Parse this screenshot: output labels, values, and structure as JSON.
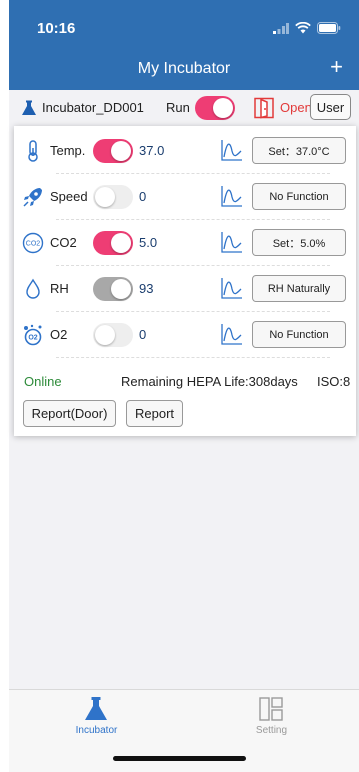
{
  "status_bar": {
    "time": "10:16"
  },
  "nav": {
    "title": "My Incubator",
    "add_label": "+"
  },
  "device": {
    "name": "Incubator_DD001",
    "run_label": "Run",
    "run_on": true,
    "open_label": "Open",
    "user_label": "User"
  },
  "params": [
    {
      "key": "temp",
      "icon": "thermometer-icon",
      "label": "Temp.",
      "toggle": "on",
      "value": "37.0",
      "button": "Set：37.0°C"
    },
    {
      "key": "speed",
      "icon": "fan-icon",
      "label": "Speed",
      "toggle": "off",
      "value": "0",
      "button": "No Function"
    },
    {
      "key": "co2",
      "icon": "co2-icon",
      "label": "CO2",
      "toggle": "on",
      "value": "5.0",
      "button": "Set：5.0%"
    },
    {
      "key": "rh",
      "icon": "droplet-icon",
      "label": "RH",
      "toggle": "dim",
      "value": "93",
      "button": "RH Naturally"
    },
    {
      "key": "o2",
      "icon": "o2-icon",
      "label": "O2",
      "toggle": "off",
      "value": "0",
      "button": "No Function"
    }
  ],
  "status": {
    "online": "Online",
    "hepa": "Remaining HEPA Life:308days",
    "iso": "ISO:8"
  },
  "reports": {
    "door": "Report(Door)",
    "report": "Report"
  },
  "tabs": [
    {
      "label": "Incubator",
      "active": true
    },
    {
      "label": "Setting",
      "active": false
    }
  ],
  "colors": {
    "header": "#2f6fb2",
    "toggle_on": "#ee3d74",
    "online": "#2e8b3a",
    "open": "#e23a3a",
    "value": "#1a3d6e",
    "tab_active": "#2f73c9",
    "tab_inactive": "#9a9a9a"
  }
}
